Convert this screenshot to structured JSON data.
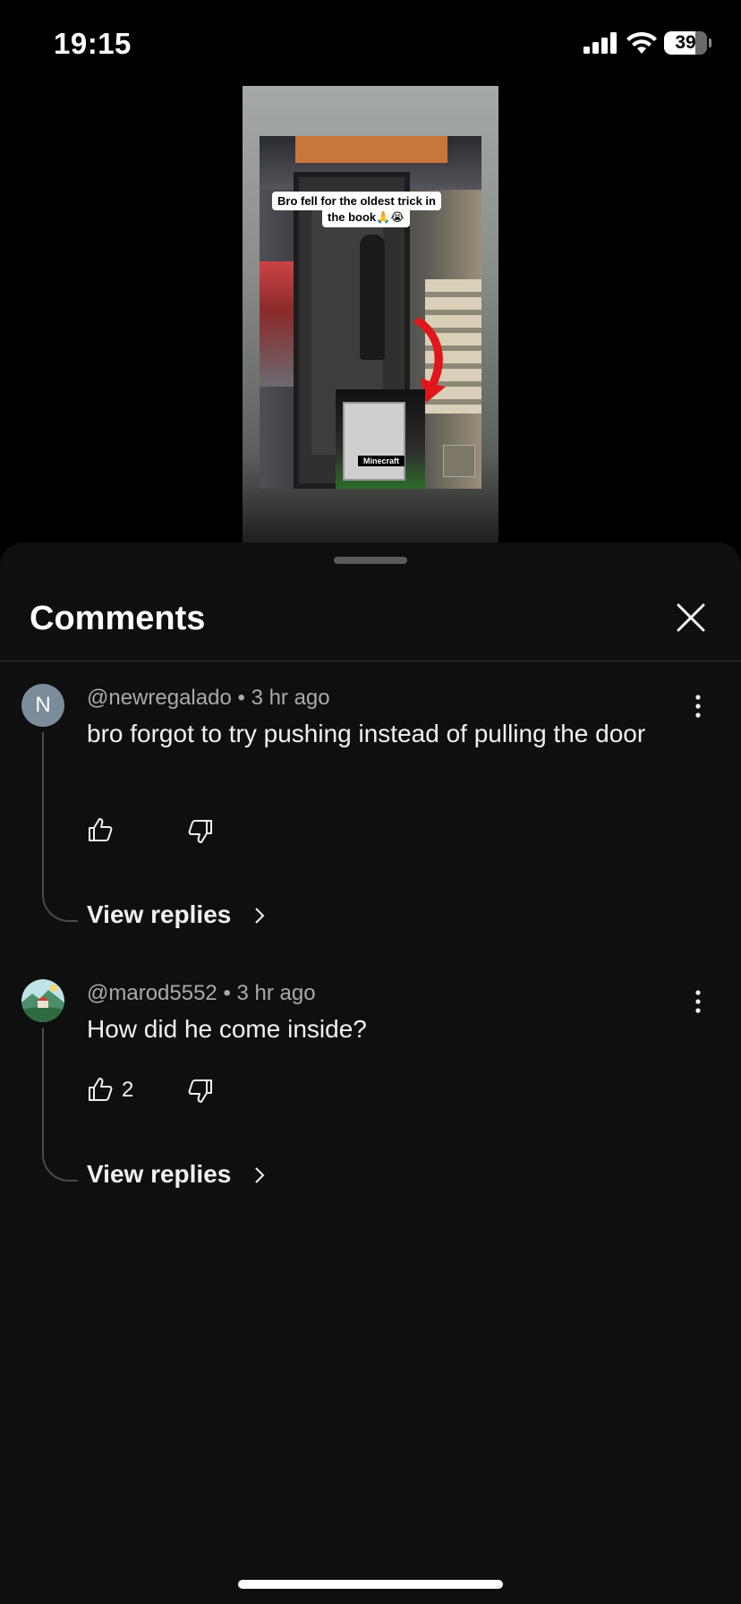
{
  "status_bar": {
    "time": "19:15",
    "battery": "39"
  },
  "video": {
    "caption_line1": "Bro fell for the oldest trick in",
    "caption_line2": "the book🙏😭",
    "inset_label": "Minecraft"
  },
  "sheet": {
    "title": "Comments"
  },
  "comments": [
    {
      "author": "@newregalado",
      "time": "3 hr ago",
      "avatar_letter": "N",
      "text": "bro forgot to try pushing instead of pulling the door",
      "likes": "",
      "view_replies": "View replies"
    },
    {
      "author": "@marod5552",
      "time": "3 hr ago",
      "text": "How did he come inside?",
      "likes": "2",
      "view_replies": "View replies"
    }
  ],
  "icons": {
    "close": "close-icon",
    "like": "thumbs-up-icon",
    "dislike": "thumbs-down-icon",
    "more": "more-vertical-icon",
    "chevron": "chevron-right-icon"
  },
  "colors": {
    "background": "#0f0f0f",
    "text": "#f1f1f1",
    "meta": "#aaaaaa"
  }
}
